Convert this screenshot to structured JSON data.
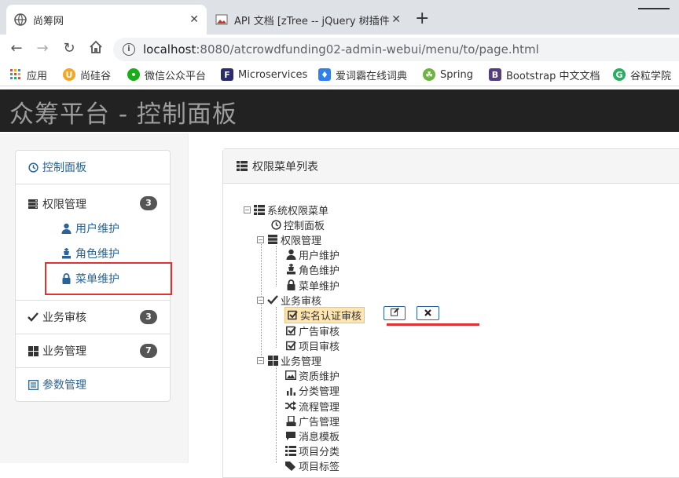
{
  "browser": {
    "tabs": [
      {
        "title": "尚筹网",
        "close": "✕"
      },
      {
        "title": "API 文档 [zTree -- jQuery 树插件",
        "close": "✕"
      }
    ],
    "new_tab": "+",
    "address": {
      "host": "localhost",
      "path": ":8080/atcrowdfunding02-admin-webui/menu/to/page.html"
    },
    "bookmarks": [
      {
        "label": "应用",
        "icon": "apps-grid-icon",
        "color": "#e8453c"
      },
      {
        "label": "尚硅谷",
        "icon": "atguigu-icon",
        "color": "#f5a623"
      },
      {
        "label": "微信公众平台",
        "icon": "wechat-icon",
        "color": "#1aad19"
      },
      {
        "label": "Microservices",
        "icon": "f-logo-icon",
        "color": "#2b2b6e"
      },
      {
        "label": "爱词霸在线词典",
        "icon": "iciba-icon",
        "color": "#2f80ed"
      },
      {
        "label": "Spring",
        "icon": "spring-icon",
        "color": "#6db33f"
      },
      {
        "label": "Bootstrap 中文文档",
        "icon": "bootstrap-icon",
        "color": "#563d7c"
      },
      {
        "label": "谷粒学院",
        "icon": "guli-icon",
        "color": "#27ae60"
      }
    ]
  },
  "app": {
    "brand": "众筹平台 - 控制面板"
  },
  "sidebar": {
    "items": [
      {
        "label": "控制面板",
        "icon": "dashboard-icon"
      },
      {
        "label": "权限管理",
        "icon": "server-icon",
        "badge": "3",
        "children": [
          {
            "label": "用户维护",
            "icon": "user-icon"
          },
          {
            "label": "角色维护",
            "icon": "king-icon"
          },
          {
            "label": "菜单维护",
            "icon": "lock-icon"
          }
        ]
      },
      {
        "label": "业务审核",
        "icon": "ok-icon",
        "badge": "3"
      },
      {
        "label": "业务管理",
        "icon": "th-large-icon",
        "badge": "7"
      },
      {
        "label": "参数管理",
        "icon": "list-alt-icon"
      }
    ]
  },
  "panel": {
    "title": "权限菜单列表",
    "tree": {
      "root": "系统权限菜单",
      "n1": "控制面板",
      "n2": "权限管理",
      "n2a": "用户维护",
      "n2b": "角色维护",
      "n2c": "菜单维护",
      "n3": "业务审核",
      "n3a": "实名认证审核",
      "n3b": "广告审核",
      "n3c": "项目审核",
      "n4": "业务管理",
      "n4a": "资质维护",
      "n4b": "分类管理",
      "n4c": "流程管理",
      "n4d": "广告管理",
      "n4e": "消息模板",
      "n4f": "项目分类",
      "n4g": "项目标签"
    },
    "edit_btn_icon": "edit-icon",
    "remove_btn_icon": "remove-icon"
  },
  "colors": {
    "highlight": "#e03232",
    "link": "#2a6496",
    "navbar": "#222222"
  }
}
